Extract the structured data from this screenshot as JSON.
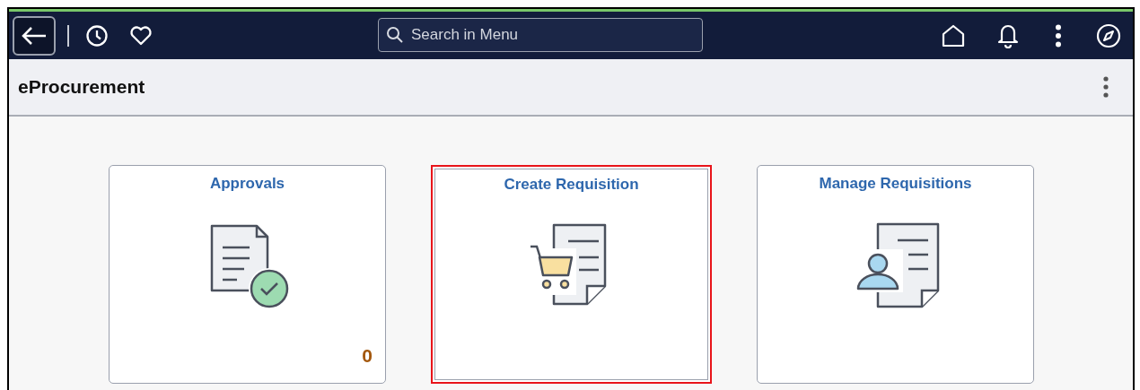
{
  "navbar": {
    "search": {
      "placeholder": "Search in Menu"
    }
  },
  "header": {
    "title": "eProcurement"
  },
  "tiles": [
    {
      "title": "Approvals",
      "kind": "approvals",
      "count": "0",
      "highlighted": false
    },
    {
      "title": "Create Requisition",
      "kind": "requisition",
      "highlighted": true
    },
    {
      "title": "Manage Requisitions",
      "kind": "manage",
      "highlighted": false
    }
  ]
}
